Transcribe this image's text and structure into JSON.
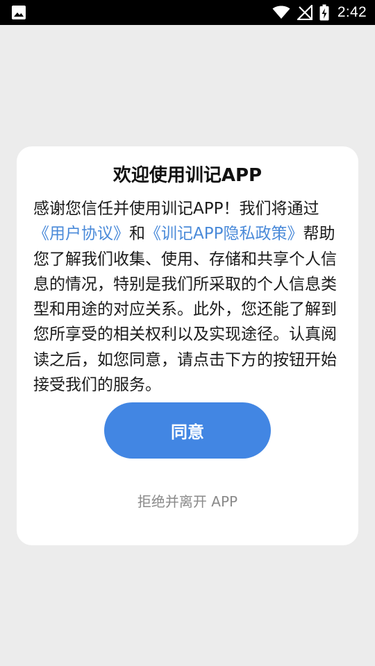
{
  "status_bar": {
    "time": "2:42",
    "icons": [
      "image-notification-icon",
      "wifi-icon",
      "signal-off-icon",
      "battery-charging-icon"
    ]
  },
  "dialog": {
    "title": "欢迎使用训记APP",
    "body_part1": "感谢您信任并使用训记APP！我们将通过",
    "link_user_agreement": "《用户协议》",
    "body_and": "和",
    "link_privacy_policy": "《训记APP隐私政策》",
    "body_part2": "帮助您了解我们收集、使用、存储和共享个人信息的情况，特别是我们所采取的个人信息类型和用途的对应关系。此外，您还能了解到您所享受的相关权利以及实现途径。认真阅读之后，如您同意，请点击下方的按钮开始接受我们的服务。",
    "agree_label": "同意",
    "reject_label": "拒绝并离开 APP"
  },
  "colors": {
    "accent": "#4286e3",
    "link": "#4a8ad9",
    "background": "#ececec"
  }
}
